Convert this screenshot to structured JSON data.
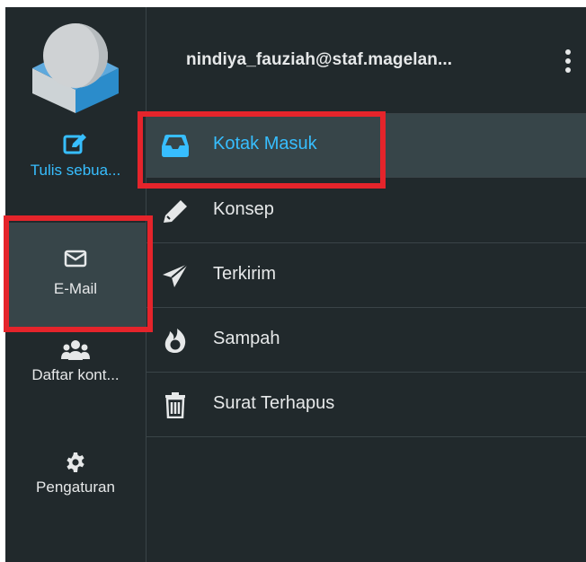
{
  "rail": {
    "compose_label": "Tulis sebua...",
    "mail_label": "E-Mail",
    "contacts_label": "Daftar kont...",
    "settings_label": "Pengaturan"
  },
  "account": {
    "email": "nindiya_fauziah@staf.magelan..."
  },
  "folders": [
    {
      "label": "Kotak Masuk",
      "icon": "inbox-icon",
      "selected": true
    },
    {
      "label": "Konsep",
      "icon": "pencil-icon"
    },
    {
      "label": "Terkirim",
      "icon": "paper-plane-icon"
    },
    {
      "label": "Sampah",
      "icon": "fire-icon"
    },
    {
      "label": "Surat Terhapus",
      "icon": "trash-icon"
    }
  ],
  "colors": {
    "background": "#21292c",
    "selected": "#374549",
    "accent": "#37beff",
    "highlight": "#e5242b"
  }
}
